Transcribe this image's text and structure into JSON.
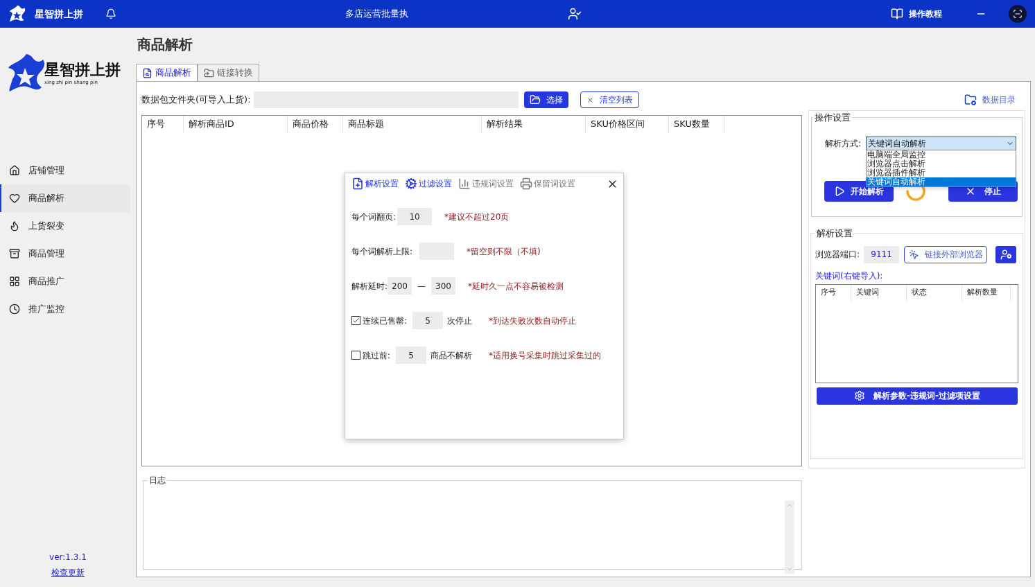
{
  "title_bar": {
    "app_name": "星智拼上拼",
    "center_title": "多店运营批量执",
    "tutorial": "操作教程"
  },
  "sidebar": {
    "logo_name": "星智拼上拼",
    "logo_subtitle": "xing zhi pin shang pin",
    "items": [
      {
        "label": "店铺管理",
        "selected": false
      },
      {
        "label": "商品解析",
        "selected": true
      },
      {
        "label": "上货裂变",
        "selected": false
      },
      {
        "label": "商品管理",
        "selected": false
      },
      {
        "label": "商品推广",
        "selected": false
      },
      {
        "label": "推广监控",
        "selected": false
      }
    ],
    "version": "ver:1.3.1",
    "update_link": "检查更新"
  },
  "page_title": "商品解析",
  "tabs": [
    {
      "label": "商品解析",
      "selected": true
    },
    {
      "label": "链接转换",
      "selected": false
    }
  ],
  "file_row": {
    "label": "数据包文件夹(可导入上货):",
    "choose_button": "选择",
    "clear_button": "清空列表",
    "data_dir_link": "数据目录"
  },
  "table": {
    "columns": [
      "序号",
      "解析商品ID",
      "商品价格",
      "商品标题",
      "解析结果",
      "SKU价格区间",
      "SKU数量"
    ]
  },
  "operation_settings": {
    "title": "操作设置",
    "mode_label": "解析方式:",
    "mode_value": "关键词自动解析",
    "dropdown_open": true,
    "options": [
      {
        "label": "电脑端全局监控",
        "selected": false
      },
      {
        "label": "浏览器点击解析",
        "selected": false
      },
      {
        "label": "浏览器插件解析",
        "selected": false
      },
      {
        "label": "关键词自动解析",
        "selected": true
      }
    ],
    "start_button": "开始解析",
    "stop_button": "停止"
  },
  "parse_settings": {
    "title": "解析设置",
    "port_label": "浏览器端口:",
    "port_value": "9111",
    "connect_button": "链接外部浏览器",
    "keywords_label": "关键词(右键导入):",
    "columns": [
      "序号",
      "关键词",
      "状态",
      "解析数量"
    ],
    "settings_button": "解析参数-违规词-过滤项设置"
  },
  "log": {
    "title": "日志"
  },
  "dialog": {
    "tabs": [
      {
        "label": "解析设置",
        "highlighted": true
      },
      {
        "label": "过滤设置",
        "highlighted": true
      },
      {
        "label": "违规词设置",
        "highlighted": false
      },
      {
        "label": "保留词设置",
        "highlighted": false
      }
    ],
    "rows": [
      {
        "kind": "field",
        "label": "每个词翻页:",
        "value": "10",
        "note": "*建议不超过20页"
      },
      {
        "kind": "field",
        "label": "每个词解析上限:",
        "note": "*留空则不限（不填)"
      },
      {
        "kind": "range",
        "label": "解析延时:",
        "from": "200",
        "separator": "—",
        "to": "300",
        "note": "*延时久一点不容易被检测"
      },
      {
        "kind": "check",
        "checked": true,
        "label": "连续已售罄:",
        "value": "5",
        "suffix": "次停止",
        "note": "*到达失败次数自动停止"
      },
      {
        "kind": "check",
        "checked": false,
        "label": "跳过前:",
        "value": "5",
        "suffix": "商品不解析",
        "note": "*适用换号采集时跳过采集过的"
      }
    ]
  }
}
